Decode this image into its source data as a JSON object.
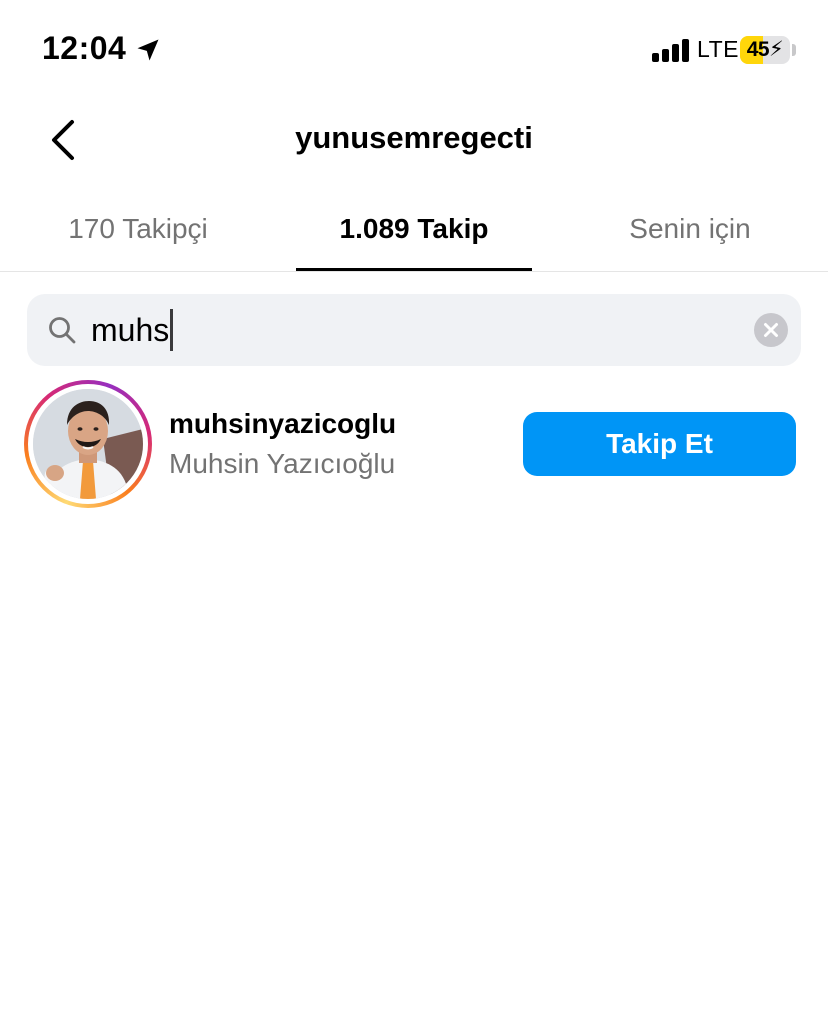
{
  "status_bar": {
    "time": "12:04",
    "network": "LTE",
    "battery_level": "45",
    "battery_percent": 0.45,
    "battery_color": "#ffd60a"
  },
  "header": {
    "title": "yunusemregecti",
    "back_icon": "chevron-left-icon"
  },
  "tabs": [
    {
      "label": "170 Takipçi",
      "active": false
    },
    {
      "label": "1.089 Takip",
      "active": true
    },
    {
      "label": "Senin için",
      "active": false
    }
  ],
  "search": {
    "value": "muhs",
    "icon": "search-icon",
    "clear_icon": "clear-icon"
  },
  "results": [
    {
      "username": "muhsinyazicoglu",
      "full_name": "Muhsin Yazıcıoğlu",
      "follow_label": "Takip Et",
      "has_story_ring": true
    }
  ],
  "colors": {
    "accent": "#0095f6",
    "secondary_text": "#737373",
    "search_bg": "#f0f2f5"
  }
}
